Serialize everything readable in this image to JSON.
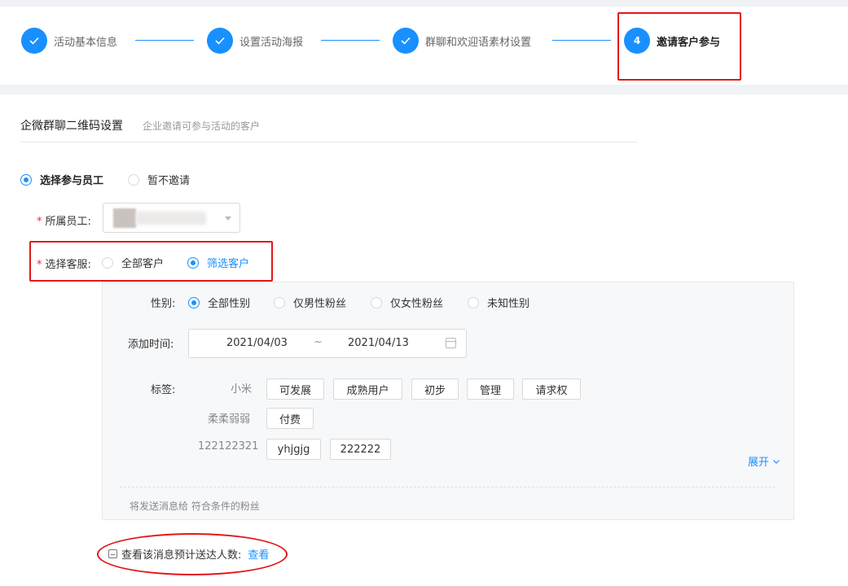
{
  "steps": [
    {
      "index": "1",
      "label": "活动基本信息",
      "state": "done"
    },
    {
      "index": "2",
      "label": "设置活动海报",
      "state": "done"
    },
    {
      "index": "3",
      "label": "群聊和欢迎语素材设置",
      "state": "done"
    },
    {
      "index": "4",
      "label": "邀请客户参与",
      "state": "active"
    }
  ],
  "section": {
    "title": "企微群聊二维码设置",
    "subtitle": "企业邀请可参与活动的客户"
  },
  "invite_options": [
    {
      "label": "选择参与员工",
      "checked": true
    },
    {
      "label": "暂不邀请",
      "checked": false
    }
  ],
  "staff": {
    "label": "所属员工:",
    "required_mark": "*"
  },
  "service": {
    "label": "选择客服:",
    "required_mark": "*",
    "options": [
      {
        "label": "全部客户",
        "checked": false
      },
      {
        "label": "筛选客户",
        "checked": true
      }
    ]
  },
  "filter": {
    "gender_label": "性别:",
    "gender_options": [
      {
        "label": "全部性别",
        "checked": true
      },
      {
        "label": "仅男性粉丝",
        "checked": false
      },
      {
        "label": "仅女性粉丝",
        "checked": false
      },
      {
        "label": "未知性别",
        "checked": false
      }
    ],
    "time_label": "添加时间:",
    "date_start": "2021/04/03",
    "date_sep": "~",
    "date_end": "2021/04/13",
    "tags_label": "标签:",
    "tag_groups": [
      {
        "name": "小米",
        "tags": [
          "可发展",
          "成熟用户",
          "初步",
          "管理",
          "请求权"
        ]
      },
      {
        "name": "柔柔弱弱",
        "tags": [
          "付费"
        ]
      },
      {
        "name": "122122321",
        "tags": [
          "yhjgjg",
          "222222"
        ]
      }
    ],
    "expand_label": "展开",
    "note": "将发送消息给 符合条件的粉丝"
  },
  "estimate": {
    "text": "查看该消息预计送达人数:",
    "link": "查看"
  },
  "colors": {
    "primary": "#1890ff",
    "annotation_red": "#e21818",
    "required": "#f5222d"
  }
}
